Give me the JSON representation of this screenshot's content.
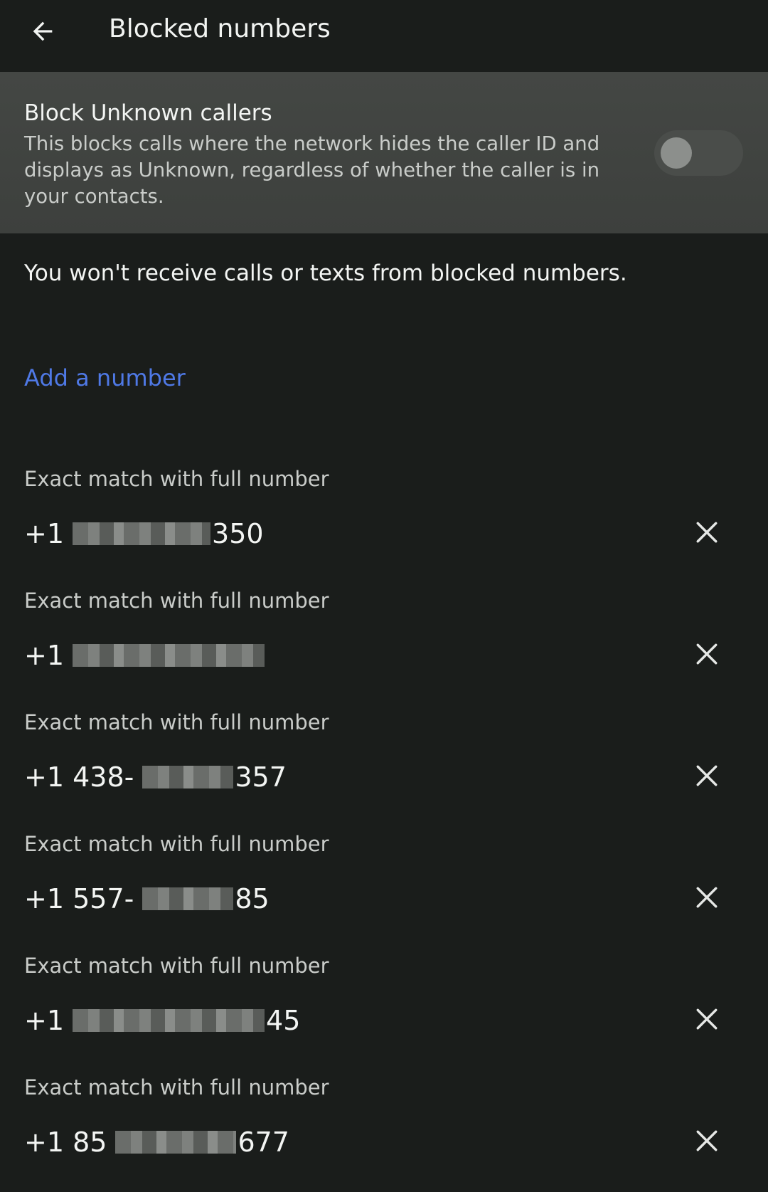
{
  "header": {
    "title": "Blocked numbers",
    "back_icon": "arrow-left-icon"
  },
  "unknown_callers": {
    "title": "Block Unknown callers",
    "description": "This blocks calls where the network hides the caller ID and displays as Unknown, regardless of whether the caller is in your contacts.",
    "enabled": false
  },
  "info_text": "You won't receive calls or texts from blocked numbers.",
  "add_number_label": "Add a number",
  "colors": {
    "background": "#1a1d1b",
    "card": "#444744",
    "link": "#4f79e6"
  },
  "blocked": [
    {
      "label": "Exact match with full number",
      "prefix": "+1",
      "suffix": "350"
    },
    {
      "label": "Exact match with full number",
      "prefix": "+1",
      "suffix": ""
    },
    {
      "label": "Exact match with full number",
      "prefix": "+1 438-",
      "suffix": "357"
    },
    {
      "label": "Exact match with full number",
      "prefix": "+1 557-",
      "suffix": "85"
    },
    {
      "label": "Exact match with full number",
      "prefix": "+1",
      "suffix": "45"
    },
    {
      "label": "Exact match with full number",
      "prefix": "+1 85",
      "suffix": "677"
    }
  ]
}
